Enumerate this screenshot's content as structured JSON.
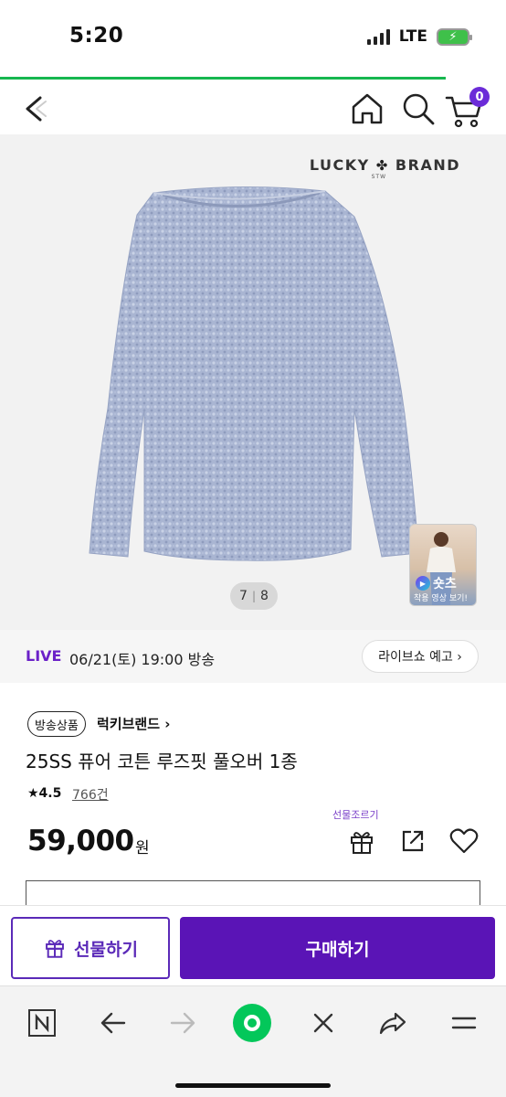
{
  "status_bar": {
    "time": "5:20",
    "network": "LTE"
  },
  "header": {
    "cart_count": "0"
  },
  "product_image": {
    "brand_logo_left": "LUCKY",
    "brand_logo_right": "BRAND",
    "brand_logo_sub": "STW",
    "counter_current": "7",
    "counter_total": "8",
    "shorts_label": "숏츠",
    "shorts_caption": "착용 영상 보기!"
  },
  "live": {
    "tag": "LIVE",
    "schedule": "06/21(토) 19:00 방송",
    "button_label": "라이브쇼 예고 ›"
  },
  "product": {
    "badge": "방송상품",
    "brand": "럭키브랜드 ›",
    "title": "25SS 퓨어 코튼 루즈핏 풀오버 1종",
    "rating": "★4.5",
    "review_count": "766건",
    "price": "59,000",
    "price_unit": "원",
    "gift_hint": "선물조르기"
  },
  "actions": {
    "gift_label": "선물하기",
    "purchase_label": "구매하기"
  },
  "colors": {
    "accent_purple": "#5a14b6",
    "progress_green": "#17b74f",
    "naver_green": "#03c75a"
  }
}
